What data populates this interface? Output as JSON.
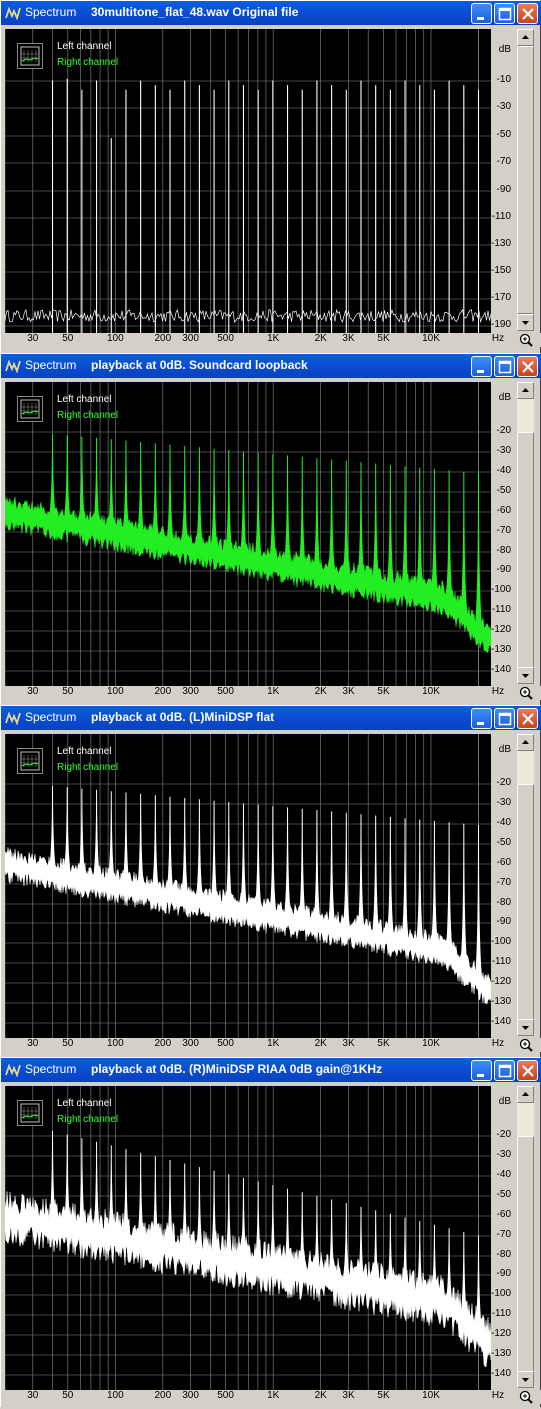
{
  "app_name": "Spectrum",
  "legend": {
    "left": "Left channel",
    "right": "Right channel"
  },
  "y_unit": "dB",
  "x_unit": "Hz",
  "x_ticks": [
    "30",
    "50",
    "100",
    "200",
    "300",
    "500",
    "1K",
    "2K",
    "3K",
    "5K",
    "10K"
  ],
  "windows": [
    {
      "title": "30multitone_flat_48.wav Original file",
      "y_ticks": [
        "dB",
        "-10",
        "-30",
        "-50",
        "-70",
        "-90",
        "-110",
        "-130",
        "-150",
        "-170",
        "-190"
      ],
      "trace_color": "#ffffff",
      "chart_data": {
        "type": "line",
        "title": "30multitone_flat_48.wav Original file",
        "xlabel": "Hz",
        "ylabel": "dB",
        "x_scale": "log",
        "ylim": [
          -195,
          0
        ],
        "series": [
          {
            "name": "Left channel",
            "description_values": "30 tones at about -33 to -45 dB, noise floor near -190 dB"
          }
        ]
      }
    },
    {
      "title": "playback at 0dB. Soundcard loopback",
      "y_ticks": [
        "dB",
        "-20",
        "-30",
        "-40",
        "-50",
        "-60",
        "-70",
        "-80",
        "-90",
        "-100",
        "-110",
        "-120",
        "-130",
        "-140"
      ],
      "trace_color": "#22ee22",
      "chart_data": {
        "type": "line",
        "title": "playback at 0dB. Soundcard loopback",
        "xlabel": "Hz",
        "ylabel": "dB",
        "x_scale": "log",
        "ylim": [
          -145,
          -10
        ],
        "series": [
          {
            "name": "Right channel"
          }
        ]
      }
    },
    {
      "title": "playback at 0dB. (L)MiniDSP flat",
      "y_ticks": [
        "dB",
        "-20",
        "-30",
        "-40",
        "-50",
        "-60",
        "-70",
        "-80",
        "-90",
        "-100",
        "-110",
        "-120",
        "-130",
        "-140"
      ],
      "trace_color": "#ffffff",
      "chart_data": {
        "type": "line",
        "title": "playback at 0dB. (L)MiniDSP flat",
        "xlabel": "Hz",
        "ylabel": "dB",
        "x_scale": "log",
        "ylim": [
          -145,
          -10
        ],
        "series": [
          {
            "name": "Left channel"
          }
        ]
      }
    },
    {
      "title": "playback at 0dB. (R)MiniDSP RIAA 0dB gain@1KHz",
      "y_ticks": [
        "dB",
        "-20",
        "-30",
        "-40",
        "-50",
        "-60",
        "-70",
        "-80",
        "-90",
        "-100",
        "-110",
        "-120",
        "-130",
        "-140"
      ],
      "trace_color": "#ffffff",
      "chart_data": {
        "type": "line",
        "title": "playback at 0dB. (R)MiniDSP RIAA 0dB gain@1KHz",
        "xlabel": "Hz",
        "ylabel": "dB",
        "x_scale": "log",
        "ylim": [
          -145,
          -10
        ],
        "series": [
          {
            "name": "Left channel"
          }
        ]
      }
    }
  ]
}
